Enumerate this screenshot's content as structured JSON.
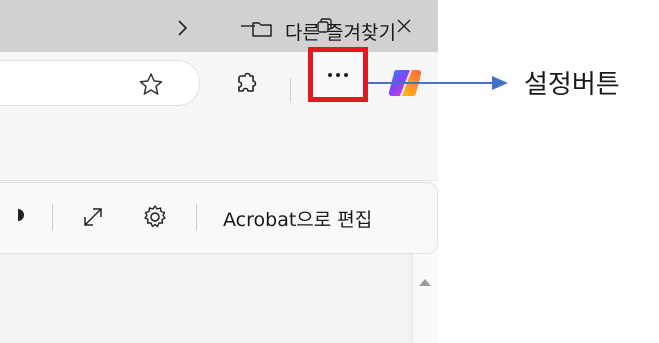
{
  "window_controls": {
    "minimize_icon": "minimize-icon",
    "restore_icon": "restore-icon",
    "close_icon": "close-icon"
  },
  "toolbar": {
    "favorite_icon": "star-icon",
    "extensions_icon": "puzzle-icon",
    "settings_icon": "more-dots-icon",
    "copilot_icon": "copilot-icon",
    "highlight_color": "#e4191f"
  },
  "favorites_bar": {
    "other_favorites_label": "다른 즐겨찾기"
  },
  "pdf_toolbar": {
    "acrobat_label": "Acrobat으로 편집"
  },
  "annotation": {
    "label": "설정버튼",
    "arrow_color": "#4472c4"
  }
}
